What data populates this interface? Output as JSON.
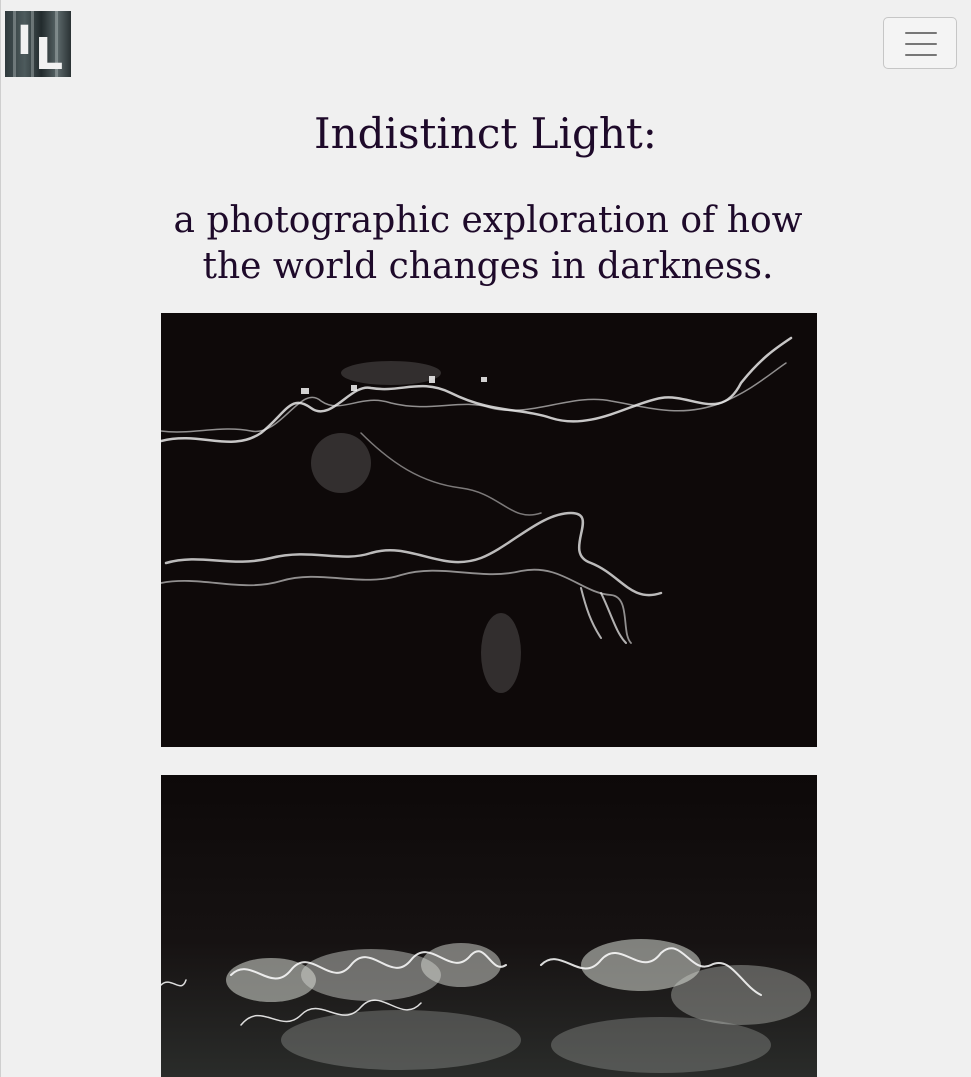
{
  "header": {
    "logo_letters": [
      "I",
      "L"
    ],
    "menu_icon": "hamburger-icon"
  },
  "hero": {
    "title": "Indistinct Light:",
    "subtitle": "a photographic exploration of how the world changes in darkness."
  },
  "gallery": {
    "photos": [
      {
        "subject": "white light trails in darkness"
      },
      {
        "subject": "blurred white light trails over dark ground"
      }
    ]
  },
  "colors": {
    "background": "#f0f0f0",
    "text": "#1e0a2a",
    "photo_background": "#0e0909"
  }
}
